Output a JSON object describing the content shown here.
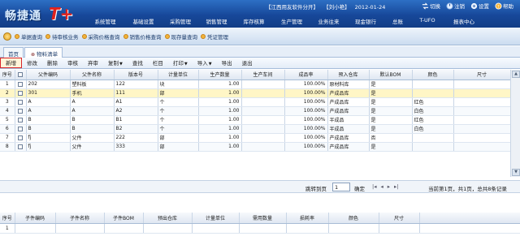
{
  "header": {
    "logo_text": "畅捷通",
    "logo_badge": "T+",
    "company": "【江西用友软件分开】",
    "user": "【刘小艳】",
    "date": "2012-01-24",
    "actions": [
      {
        "label": "切换",
        "icon": "switch-icon"
      },
      {
        "label": "注销",
        "icon": "logout-icon"
      },
      {
        "label": "设置",
        "icon": "gear-icon"
      },
      {
        "label": "帮助",
        "icon": "help-icon"
      }
    ],
    "nav": [
      "系统管理",
      "基础设置",
      "采购管理",
      "销售管理",
      "库存核算",
      "生产管理",
      "业务往来",
      "现金银行",
      "总账",
      "T-UFO",
      "报表中心"
    ]
  },
  "quickbar": {
    "items": [
      "单据查询",
      "待审核业务",
      "采购价格查询",
      "销售价格查询",
      "现存量查询",
      "凭证管理"
    ]
  },
  "tabs": [
    {
      "label": "首页",
      "active": false
    },
    {
      "label": "物料清单",
      "active": true,
      "closable": true
    }
  ],
  "toolbar": [
    {
      "label": "新增"
    },
    {
      "label": "修改"
    },
    {
      "label": "删除"
    },
    {
      "label": "审核"
    },
    {
      "label": "弃审"
    },
    {
      "label": "复制",
      "dropdown": true
    },
    {
      "label": "查找"
    },
    {
      "label": "栏目"
    },
    {
      "label": "打印",
      "dropdown": true
    },
    {
      "label": "导入",
      "dropdown": true
    },
    {
      "label": "导出"
    },
    {
      "label": "退出"
    }
  ],
  "grid": {
    "columns": [
      "序号",
      "",
      "父件编码",
      "父件名称",
      "版本号",
      "计量单位",
      "生产数量",
      "生产车间",
      "成品率",
      "预入仓库",
      "默认BOM",
      "颜色",
      "尺寸"
    ],
    "rows": [
      {
        "no": "1",
        "code": "202",
        "name": "塑料板",
        "version": "122",
        "unit": "块",
        "qty": "1.00",
        "workshop": "",
        "yield": "100.00%",
        "warehouse": "原材料库",
        "default_bom": "是",
        "color": "",
        "size": ""
      },
      {
        "no": "2",
        "code": "301",
        "name": "手机",
        "version": "111",
        "unit": "部",
        "qty": "1.00",
        "workshop": "",
        "yield": "100.00%",
        "warehouse": "产成品库",
        "default_bom": "是",
        "color": "",
        "size": ""
      },
      {
        "no": "3",
        "code": "A",
        "name": "A",
        "version": "A1",
        "unit": "个",
        "qty": "1.00",
        "workshop": "",
        "yield": "100.00%",
        "warehouse": "产成品库",
        "default_bom": "是",
        "color": "红色",
        "size": ""
      },
      {
        "no": "4",
        "code": "A",
        "name": "A",
        "version": "A2",
        "unit": "个",
        "qty": "1.00",
        "workshop": "",
        "yield": "100.00%",
        "warehouse": "产成品库",
        "default_bom": "是",
        "color": "白色",
        "size": ""
      },
      {
        "no": "5",
        "code": "B",
        "name": "B",
        "version": "B1",
        "unit": "个",
        "qty": "1.00",
        "workshop": "",
        "yield": "100.00%",
        "warehouse": "半成品",
        "default_bom": "是",
        "color": "红色",
        "size": ""
      },
      {
        "no": "6",
        "code": "B",
        "name": "B",
        "version": "B2",
        "unit": "个",
        "qty": "1.00",
        "workshop": "",
        "yield": "100.00%",
        "warehouse": "半成品",
        "default_bom": "是",
        "color": "白色",
        "size": ""
      },
      {
        "no": "7",
        "code": "fj",
        "name": "父件",
        "version": "222",
        "unit": "部",
        "qty": "1.00",
        "workshop": "",
        "yield": "100.00%",
        "warehouse": "产成品库",
        "default_bom": "否",
        "color": "",
        "size": ""
      },
      {
        "no": "8",
        "code": "fj",
        "name": "父件",
        "version": "333",
        "unit": "部",
        "qty": "1.00",
        "workshop": "",
        "yield": "100.00%",
        "warehouse": "产成品库",
        "default_bom": "是",
        "color": "",
        "size": ""
      }
    ],
    "selected_row": 2
  },
  "pager": {
    "jump_label": "跳转到页",
    "page_value": "1",
    "confirm_label": "确定",
    "info": "当前第1页，共1页，总共8条记录"
  },
  "detail": {
    "columns": [
      "序号",
      "子件编码",
      "子件名称",
      "子件BOM",
      "预出仓库",
      "计量单位",
      "需用数量",
      "损耗率",
      "颜色",
      "尺寸"
    ],
    "rows": [
      {
        "no": "1"
      }
    ]
  }
}
